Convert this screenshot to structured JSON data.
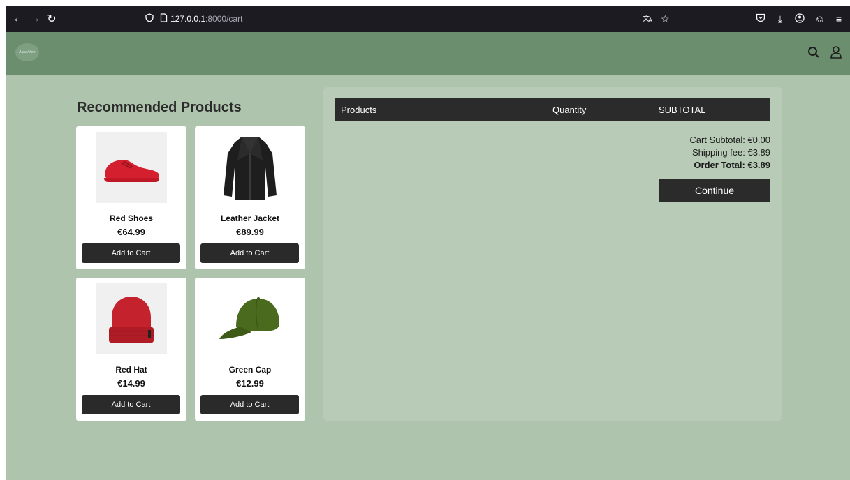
{
  "browser": {
    "url_host": "127.0.0.1",
    "url_path": ":8000/cart"
  },
  "site": {
    "logo_text": "Aura Attire"
  },
  "recommended": {
    "title": "Recommended Products",
    "products": [
      {
        "name": "Red Shoes",
        "price": "€64.99",
        "button": "Add to Cart"
      },
      {
        "name": "Leather Jacket",
        "price": "€89.99",
        "button": "Add to Cart"
      },
      {
        "name": "Red Hat",
        "price": "€14.99",
        "button": "Add to Cart"
      },
      {
        "name": "Green Cap",
        "price": "€12.99",
        "button": "Add to Cart"
      }
    ]
  },
  "cart": {
    "columns": {
      "products": "Products",
      "quantity": "Quantity",
      "subtotal": "SUBTOTAL"
    },
    "cart_subtotal": "Cart Subtotal: €0.00",
    "shipping_fee": "Shipping fee: €3.89",
    "order_total": "Order Total: €3.89",
    "continue_label": "Continue"
  },
  "colors": {
    "header": "#6b8e6e",
    "page": "#aec4ac",
    "panel": "#b7cbb6",
    "dark_button": "#2a2a2a"
  }
}
